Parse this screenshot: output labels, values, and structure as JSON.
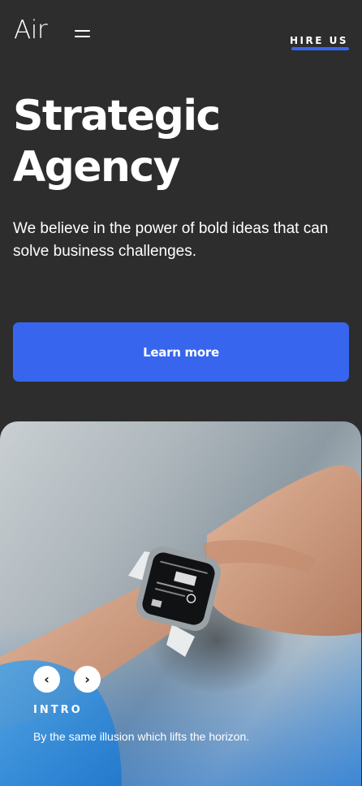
{
  "header": {
    "logo": "Air",
    "menu_icon": "hamburger-menu-icon",
    "hire_us": "HIRE US"
  },
  "hero": {
    "headline_line1": "Strategic",
    "headline_line2": "Agency",
    "subtitle": "We believe in the power of bold ideas that can solve business challenges.",
    "cta_label": "Learn more"
  },
  "slide": {
    "prev_icon": "chevron-left-icon",
    "next_icon": "chevron-right-icon",
    "prev_glyph": "‹",
    "next_glyph": "›",
    "label": "INTRO",
    "caption": "By the same illusion which lifts the horizon."
  },
  "colors": {
    "background": "#2d2d2d",
    "accent": "#3765ee",
    "text": "#ffffff"
  }
}
